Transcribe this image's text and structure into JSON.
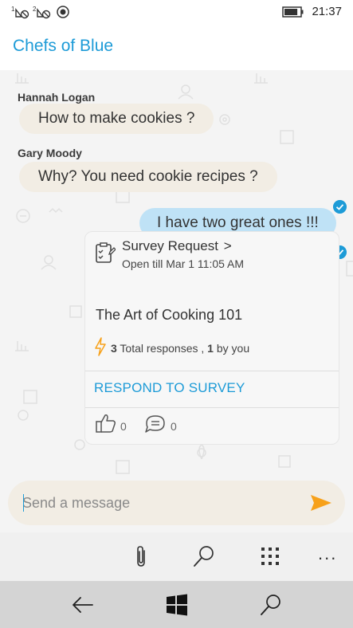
{
  "status_bar": {
    "sim1_label": "1",
    "sim2_label": "2",
    "time": "21:37",
    "battery_level": 0.85
  },
  "header": {
    "title": "Chefs of Blue"
  },
  "messages": [
    {
      "sender": "Hannah Logan",
      "text": "How to make cookies ?"
    },
    {
      "sender": "Gary Moody",
      "text": "Why? You need cookie recipes ?"
    },
    {
      "sender": "",
      "text": "I have two great ones !!!"
    }
  ],
  "survey": {
    "title": "Survey Request",
    "chevron": ">",
    "open_till": "Open till Mar 1 11:05 AM",
    "name": "The Art of Cooking 101",
    "responses_count": "3",
    "responses_label": " Total responses , ",
    "by_you_count": "1",
    "by_you_label": " by you",
    "respond_label": "RESPOND TO SURVEY",
    "likes": "0",
    "comments": "0"
  },
  "composer": {
    "placeholder": "Send a message"
  },
  "app_bar": {
    "more_label": "..."
  },
  "colors": {
    "accent": "#1d9bd7",
    "incoming_bubble": "#f2ede4",
    "outgoing_bubble": "#bfe2f6",
    "send_arrow": "#f7a11a",
    "lightning": "#f7a11a"
  },
  "icons": {
    "attach": "paperclip-icon",
    "search": "search-icon",
    "apps": "grid-icon",
    "back": "back-arrow-icon",
    "home": "windows-logo-icon",
    "nav_search": "search-icon"
  }
}
